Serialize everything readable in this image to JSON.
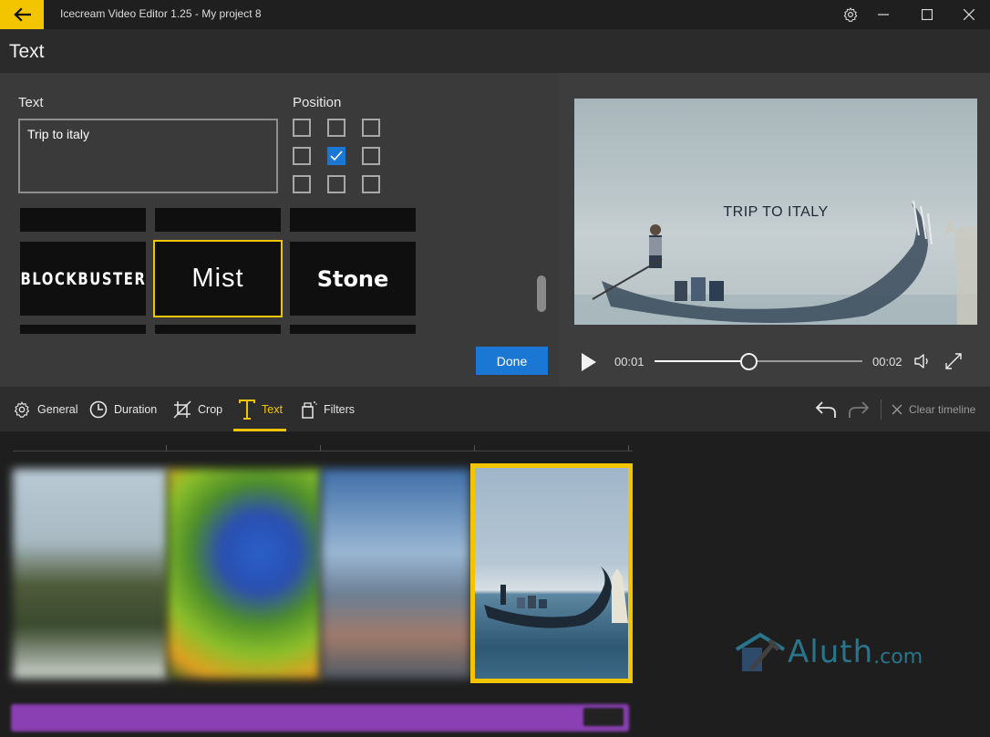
{
  "app": {
    "window_title": "Icecream Video Editor 1.25 - My project 8"
  },
  "page": {
    "title": "Text"
  },
  "editor": {
    "text_label": "Text",
    "text_value": "Trip to italy",
    "position_label": "Position",
    "position_selected": "middle-center",
    "styles": [
      "BLOCKBUSTER",
      "Mist",
      "Stone"
    ],
    "selected_style": "Mist",
    "done_label": "Done"
  },
  "preview": {
    "caption": "TRIP TO ITALY",
    "current_time": "00:01",
    "total_time": "00:02",
    "progress": 0.45
  },
  "toolbar": {
    "tabs": [
      "General",
      "Duration",
      "Crop",
      "Text",
      "Filters"
    ],
    "active_tab": "Text",
    "clear_timeline": "Clear timeline"
  },
  "watermark": {
    "text": "Aluth",
    "suffix": ".com"
  },
  "colors": {
    "accent": "#f2c500",
    "primary_button": "#1a78d4",
    "audio_track": "#8a3fb2"
  }
}
